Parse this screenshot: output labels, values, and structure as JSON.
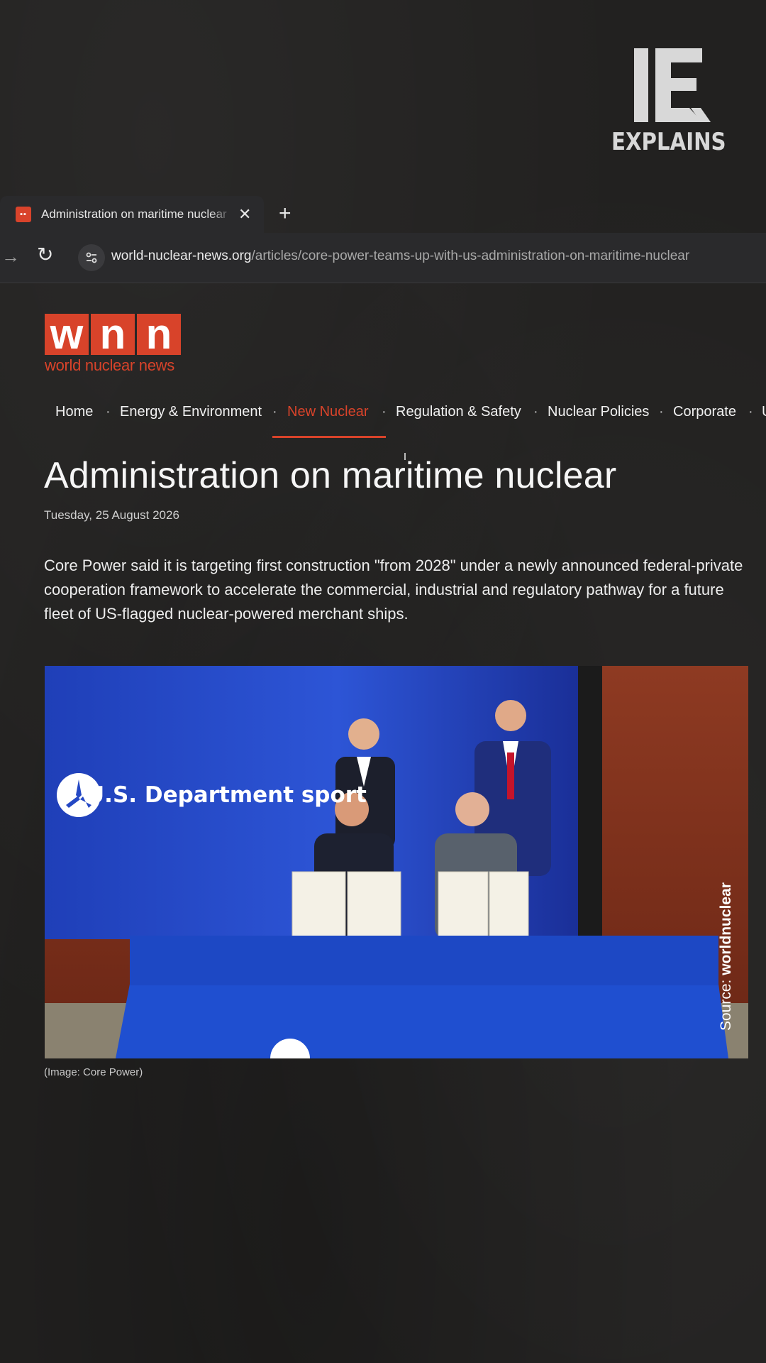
{
  "brand": {
    "logo_letters": "IE",
    "word": "EXPLAINS"
  },
  "browser": {
    "tab_title": "Administration on maritime nuclear",
    "favicon_text": "wnn",
    "url_domain": "world-nuclear-news.org",
    "url_path": "/articles/core-power-teams-up-with-us-administration-on-maritime-nuclear"
  },
  "site": {
    "logo_letters": [
      "w",
      "n",
      "n"
    ],
    "tagline": "world nuclear news",
    "accent_color": "#d8432a"
  },
  "nav": {
    "items": [
      "Home",
      "Energy & Environment",
      "New Nuclear",
      "Regulation & Safety",
      "Nuclear Policies",
      "Corporate",
      "U"
    ],
    "active": "New Nuclear"
  },
  "article": {
    "headline": "Administration on maritime nuclear",
    "date": "Tuesday, 25 August 2026",
    "lead": "Core Power said it is targeting first construction \"from 2028\" under a newly announced federal-private cooperation framework to accelerate the commercial, industrial and regulatory pathway for a future fleet of US-flagged nuclear-powered merchant ships.",
    "photo_banner_text": "U.S. Department    sport",
    "source_prefix": "Source: ",
    "source_name": "worldnuclear",
    "caption": "(Image: Core Power)"
  }
}
